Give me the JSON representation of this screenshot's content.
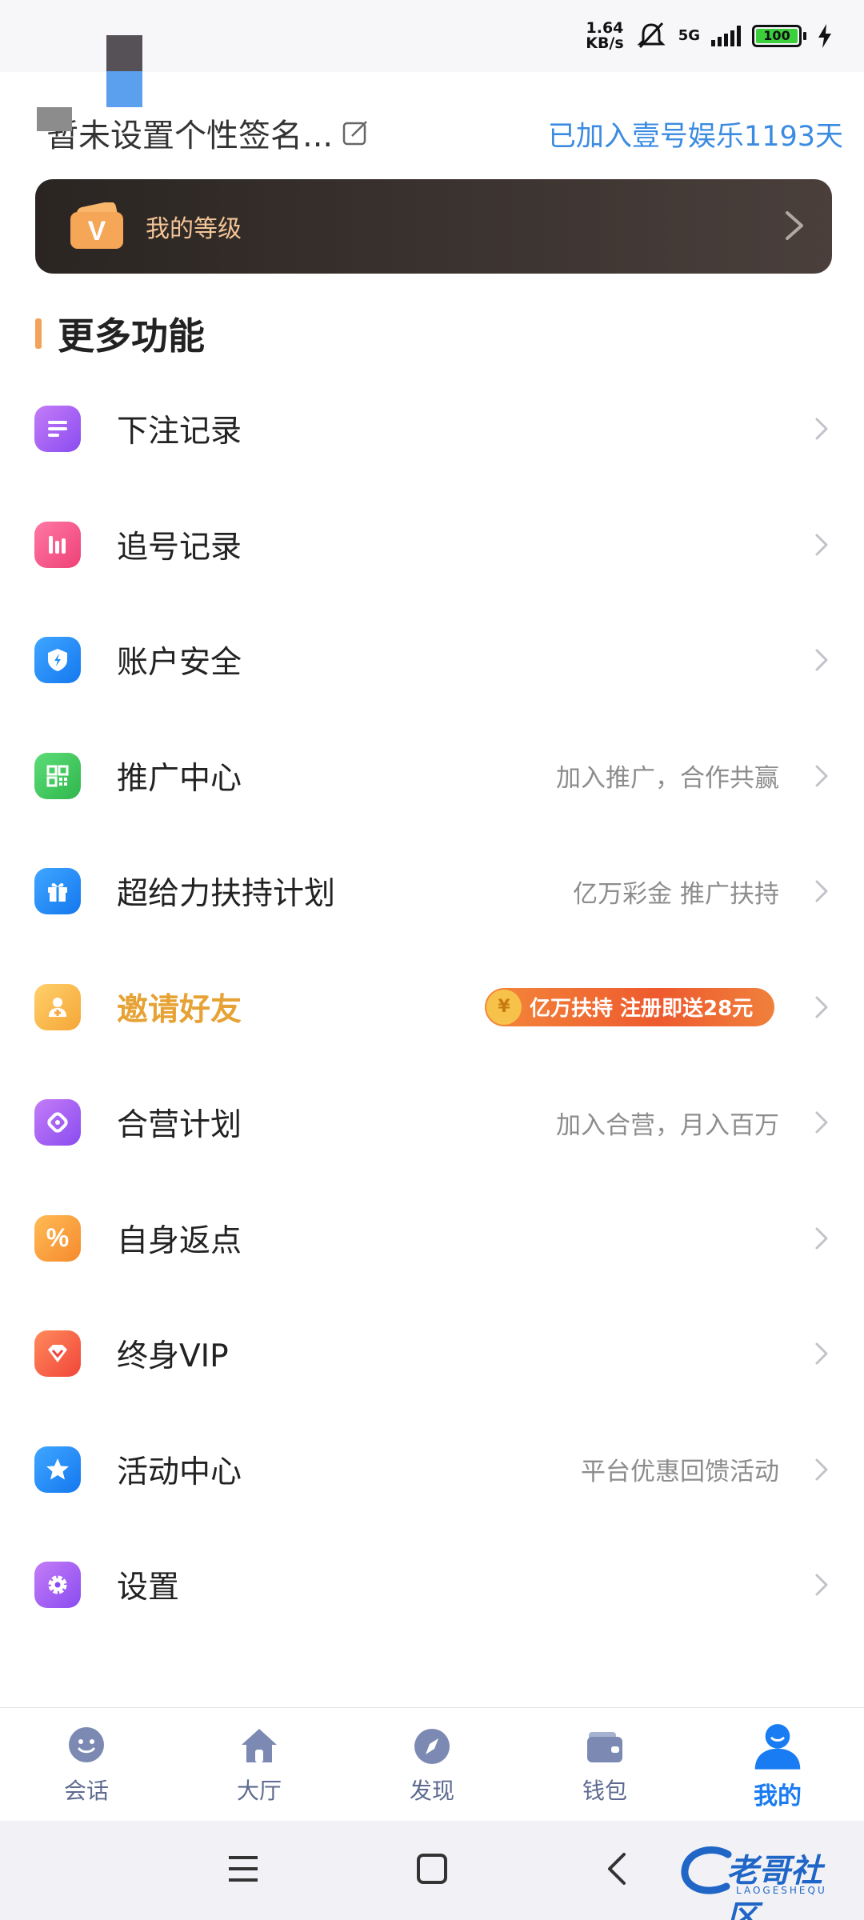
{
  "status_bar": {
    "speed_value": "1.64",
    "speed_unit": "KB/s",
    "network": "5G",
    "battery": "100",
    "icons": [
      "mute-bell-icon",
      "signal-icon",
      "battery-icon",
      "charging-bolt-icon"
    ]
  },
  "profile": {
    "signature": "暂未设置个性签名...",
    "joined": "已加入壹号娱乐1193天"
  },
  "level_card": {
    "badge": "V",
    "label": "我的等级"
  },
  "section": {
    "title": "更多功能"
  },
  "menu": [
    {
      "label": "下注记录",
      "sub": "",
      "icon": "list-icon",
      "color": "#a45cf0"
    },
    {
      "label": "追号记录",
      "sub": "",
      "icon": "bar-chart-icon",
      "color": "#f0508a"
    },
    {
      "label": "账户安全",
      "sub": "",
      "icon": "shield-icon",
      "color": "#1e8ef5"
    },
    {
      "label": "推广中心",
      "sub": "加入推广，合作共赢",
      "icon": "qr-code-icon",
      "color": "#3cc85a"
    },
    {
      "label": "超给力扶持计划",
      "sub": "亿万彩金 推广扶持",
      "icon": "gift-icon",
      "color": "#1e8ef5"
    },
    {
      "label": "邀请好友",
      "sub": "",
      "icon": "invite-user-icon",
      "color": "#f7b447",
      "promo": "亿万扶持 注册即送28元"
    },
    {
      "label": "合营计划",
      "sub": "加入合营，月入百万",
      "icon": "partnership-icon",
      "color": "#a45cf0"
    },
    {
      "label": "自身返点",
      "sub": "",
      "icon": "percent-icon",
      "color": "#f5a63a"
    },
    {
      "label": "终身VIP",
      "sub": "",
      "icon": "diamond-icon",
      "color": "#f5604a"
    },
    {
      "label": "活动中心",
      "sub": "平台优惠回馈活动",
      "icon": "star-icon",
      "color": "#1e8ef5"
    },
    {
      "label": "设置",
      "sub": "",
      "icon": "gear-icon",
      "color": "#a45cf0"
    }
  ],
  "bottom_nav": [
    {
      "label": "会话",
      "icon": "chat-icon",
      "active": false
    },
    {
      "label": "大厅",
      "icon": "home-icon",
      "active": false
    },
    {
      "label": "发现",
      "icon": "compass-icon",
      "active": false
    },
    {
      "label": "钱包",
      "icon": "wallet-icon",
      "active": false
    },
    {
      "label": "我的",
      "icon": "user-icon",
      "active": true
    }
  ],
  "watermark": {
    "text": "老哥社区",
    "sub": "LAOGESHEQU"
  }
}
